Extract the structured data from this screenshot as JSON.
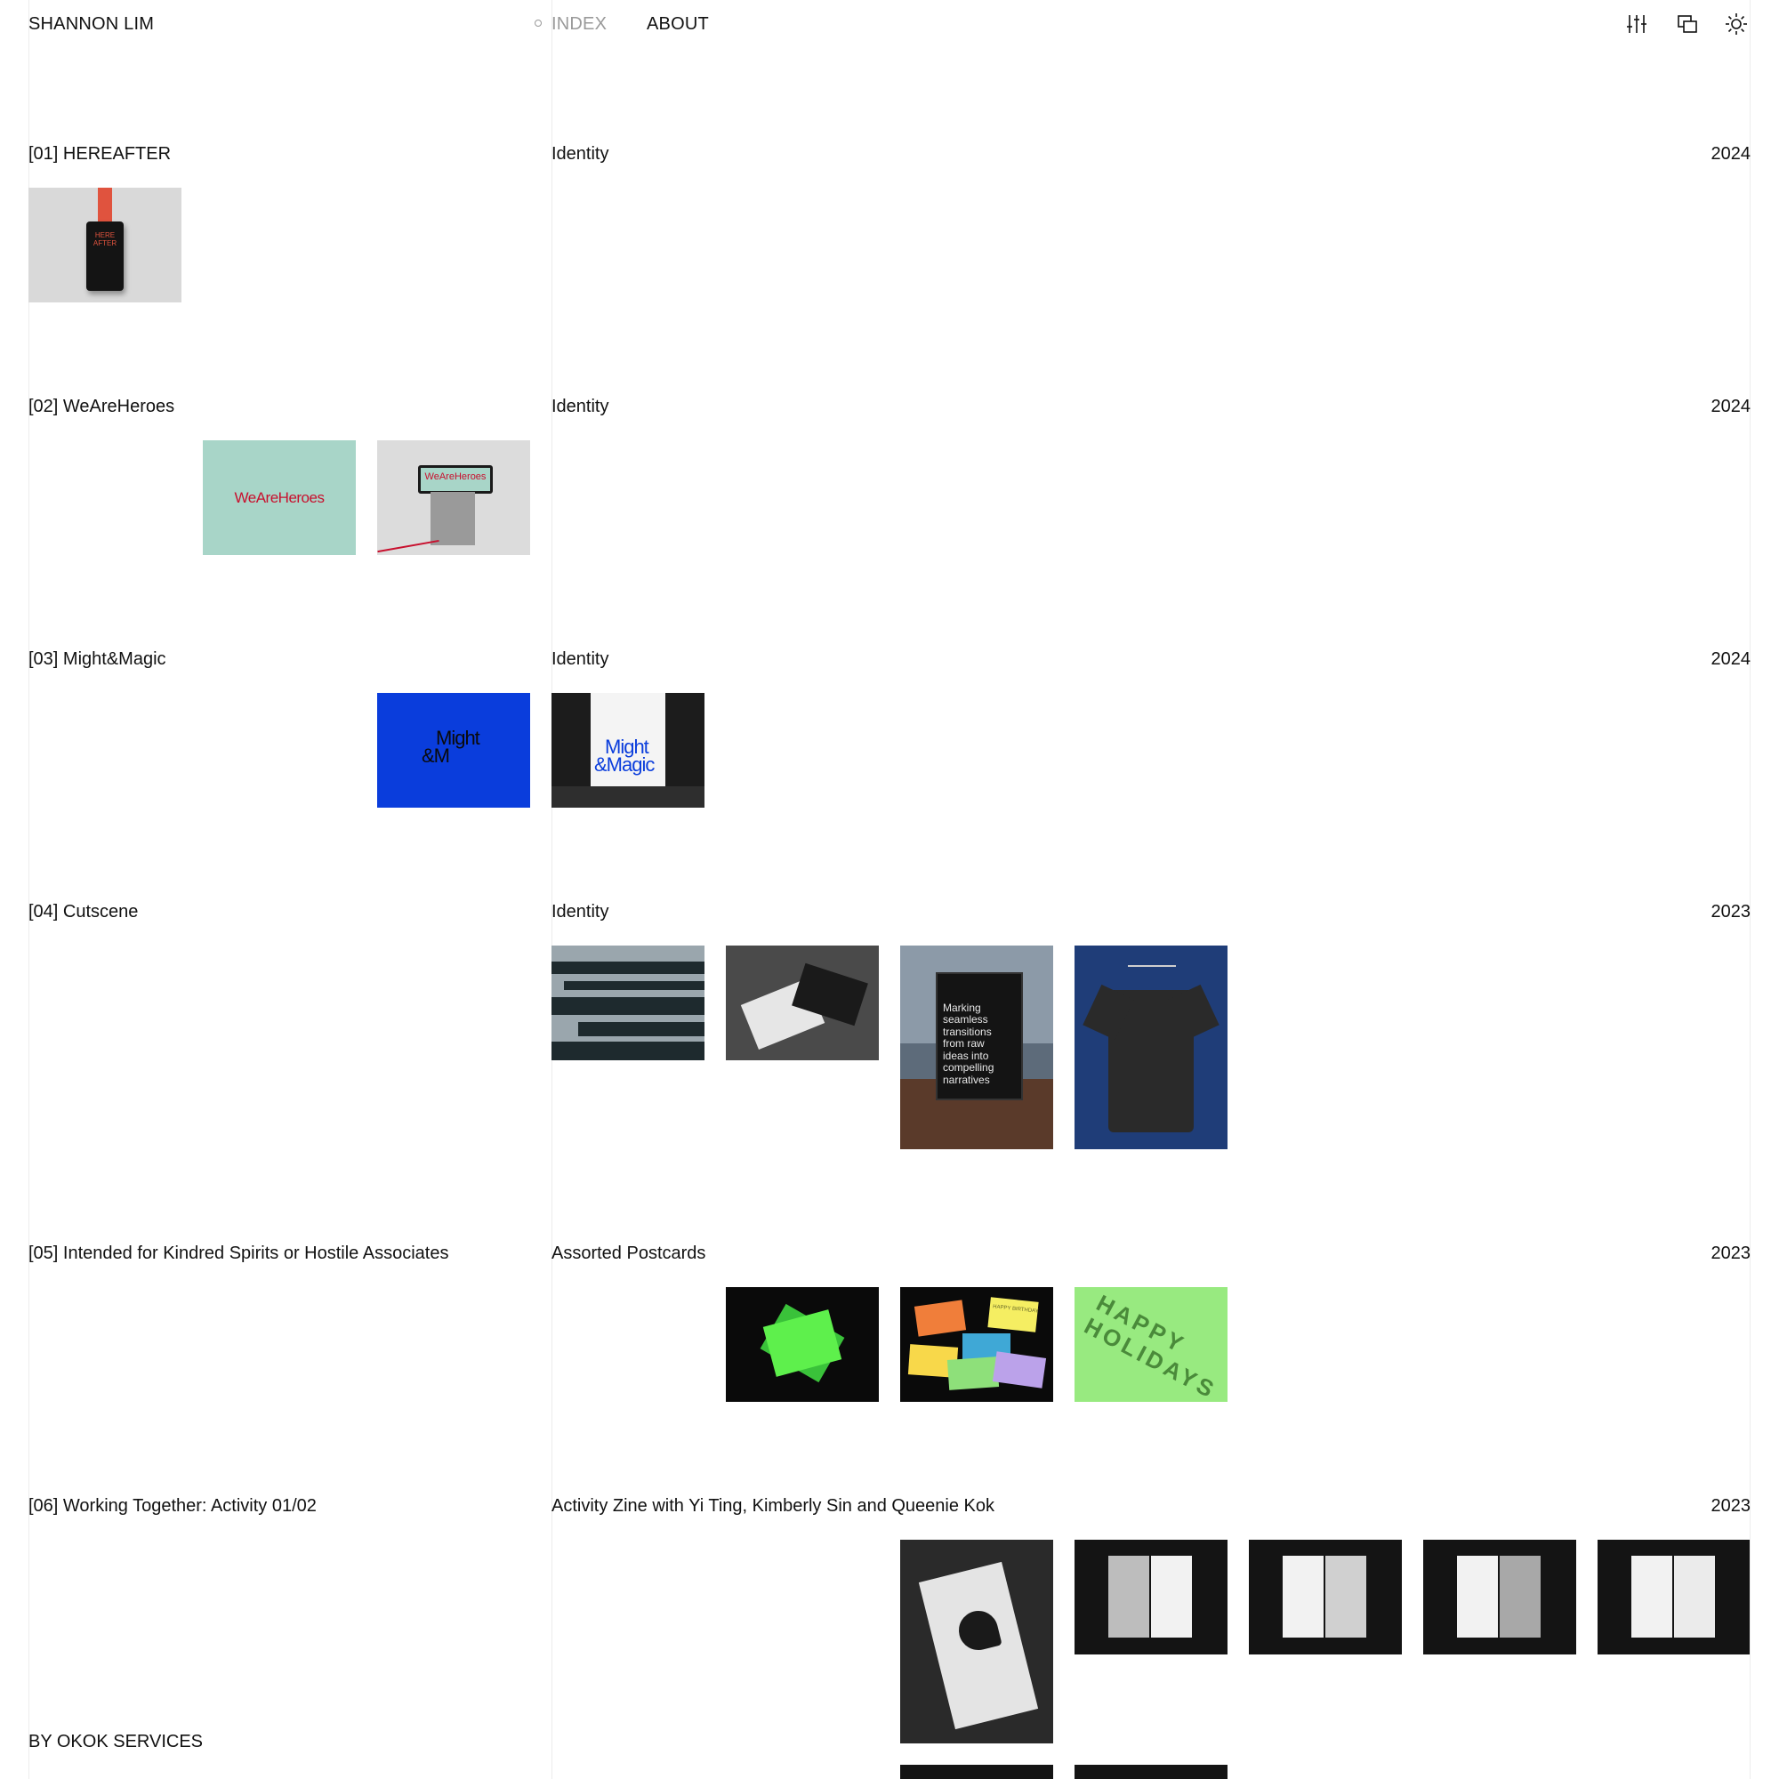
{
  "header": {
    "brand": "SHANNON LIM",
    "nav": [
      {
        "label": "INDEX",
        "active": true
      },
      {
        "label": "ABOUT",
        "active": false
      }
    ],
    "icons": [
      "sliders-icon",
      "windows-icon",
      "sun-icon"
    ]
  },
  "projects": [
    {
      "title": "[01] HEREAFTER",
      "category": "Identity",
      "year": "2024"
    },
    {
      "title": "[02] WeAreHeroes",
      "category": "Identity",
      "year": "2024"
    },
    {
      "title": "[03] Might&Magic",
      "category": "Identity",
      "year": "2024"
    },
    {
      "title": "[04] Cutscene",
      "category": "Identity",
      "year": "2023"
    },
    {
      "title": "[05] Intended for Kindred Spirits or Hostile Associates",
      "category": "Assorted Postcards",
      "year": "2023"
    },
    {
      "title": "[06] Working Together: Activity 01/02",
      "category": "Activity Zine with Yi Ting, Kimberly Sin and Queenie Kok",
      "year": "2023"
    }
  ],
  "thumbnails": {
    "hereafter_label": "HERE AFTER",
    "weareheroes_label": "WeAreHeroes",
    "might_label_line1": "Might",
    "might_label_line2": "&M",
    "mightmagic_label_line1": "Might",
    "mightmagic_label_line2": "&Magic",
    "cutscene_billboard": [
      "Marking",
      "seamless",
      "transitions",
      "from raw",
      "ideas into",
      "compelling",
      "narratives"
    ],
    "postcard_label": "HAPPY BIRTHDAY",
    "holidays_label": "HAPPY HOLIDAYS"
  },
  "footer": {
    "credit": "BY OKOK SERVICES"
  },
  "colors": {
    "accent_blue": "#0a3ddc",
    "mint": "#a8d5c8",
    "neon_green": "#5ef04c",
    "light_green": "#98ea80",
    "sky_blue": "#1f3d78"
  }
}
